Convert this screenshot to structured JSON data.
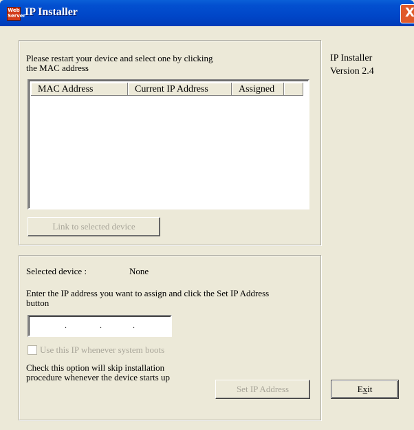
{
  "window": {
    "title": "IP Installer",
    "icon_label_1": "Web",
    "icon_label_2": "Server",
    "close_glyph": "X"
  },
  "device_list_group": {
    "instructions": [
      "Please restart your device and select one by clicking",
      "the MAC address"
    ],
    "columns": [
      "MAC Address",
      "Current IP Address",
      "Assigned"
    ],
    "rows": [],
    "link_button": "Link to selected device"
  },
  "info": {
    "product": "IP Installer",
    "version": "Version 2.4"
  },
  "assign_group": {
    "selected_label": "Selected device :",
    "selected_value": "None",
    "instructions": [
      "Enter the IP address you want to assign and click the Set IP Address",
      "button"
    ],
    "ip_octets": [
      "",
      "",
      "",
      ""
    ],
    "checkbox_label": "Use this IP whenever system boots",
    "checkbox_checked": false,
    "note": [
      "Check this option will skip installation",
      "procedure whenever the device starts up"
    ],
    "set_ip_button": "Set IP Address"
  },
  "exit_button": {
    "pre": "E",
    "accel": "x",
    "post": "it"
  }
}
